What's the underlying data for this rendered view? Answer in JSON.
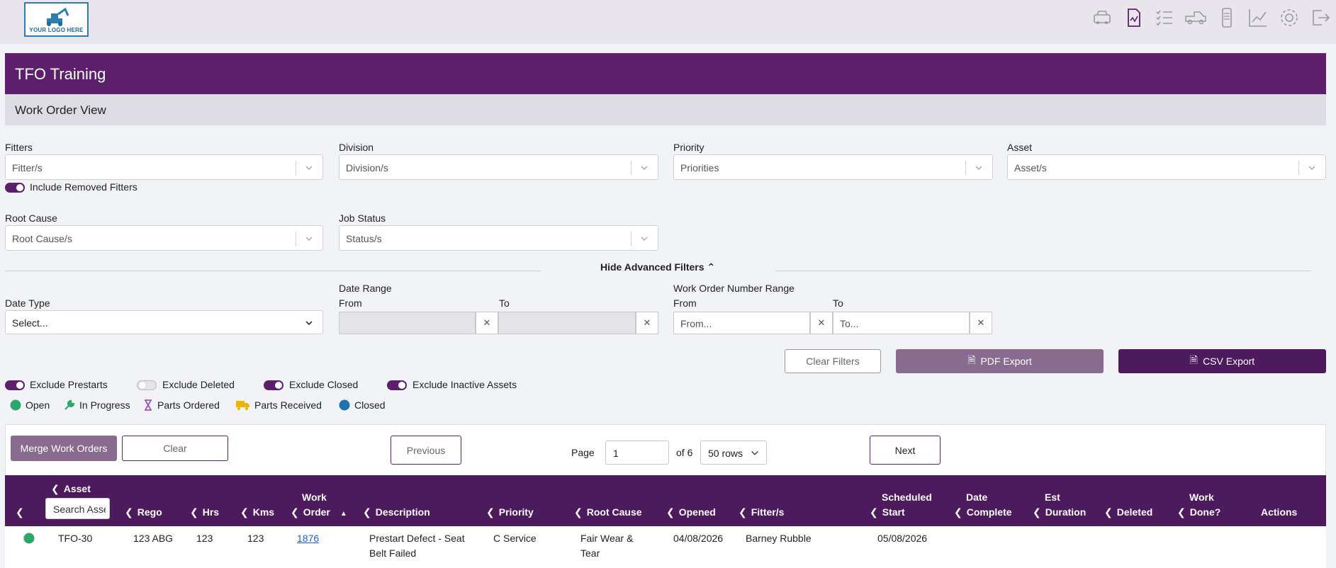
{
  "topbar": {
    "logo_text": "YOUR LOGO HERE",
    "icons": [
      "car-icon",
      "report-icon",
      "checklist-icon",
      "truck-icon",
      "mobile-icon",
      "chart-icon",
      "settings-icon",
      "logout-icon"
    ]
  },
  "header": {
    "title": "TFO Training",
    "subtitle": "Work Order View"
  },
  "filters": {
    "fitters": {
      "label": "Fitters",
      "placeholder": "Fitter/s"
    },
    "division": {
      "label": "Division",
      "placeholder": "Division/s"
    },
    "priority": {
      "label": "Priority",
      "placeholder": "Priorities"
    },
    "asset": {
      "label": "Asset",
      "placeholder": "Asset/s"
    },
    "include_removed": "Include Removed Fitters",
    "root_cause": {
      "label": "Root Cause",
      "placeholder": "Root Cause/s"
    },
    "job_status": {
      "label": "Job Status",
      "placeholder": "Status/s"
    },
    "hide_advanced": "Hide Advanced Filters",
    "date_type": {
      "label": "Date Type",
      "value": "Select..."
    },
    "date_range": {
      "label": "Date Range",
      "from": "From",
      "to": "To"
    },
    "wo_range": {
      "label": "Work Order Number Range",
      "from": "From",
      "to": "To",
      "from_placeholder": "From...",
      "to_placeholder": "To..."
    }
  },
  "actions": {
    "clear_filters": "Clear Filters",
    "pdf_export": "PDF Export",
    "csv_export": "CSV Export"
  },
  "toggles": [
    {
      "label": "Exclude Prestarts",
      "on": true
    },
    {
      "label": "Exclude Deleted",
      "on": false
    },
    {
      "label": "Exclude Closed",
      "on": true
    },
    {
      "label": "Exclude Inactive Assets",
      "on": true
    }
  ],
  "legend": [
    {
      "label": "Open",
      "icon": "open-circle",
      "color": "#2aa86a"
    },
    {
      "label": "In Progress",
      "icon": "wrench",
      "color": "#2aa86a"
    },
    {
      "label": "Parts Ordered",
      "icon": "hourglass",
      "color": "#9b59b6"
    },
    {
      "label": "Parts Received",
      "icon": "truck",
      "color": "#f0b400"
    },
    {
      "label": "Closed",
      "icon": "closed-circle",
      "color": "#1f73b0"
    }
  ],
  "toolbar": {
    "merge": "Merge Work Orders",
    "clear": "Clear",
    "previous": "Previous",
    "page_label": "Page",
    "page_value": "1",
    "of_label": "of 6",
    "rows_value": "50 rows",
    "next": "Next"
  },
  "table": {
    "headers": {
      "asset": "Asset",
      "search_placeholder": "Search Asset",
      "rego": "Rego",
      "hrs": "Hrs",
      "kms": "Kms",
      "work_order_1": "Work",
      "work_order_2": "Order",
      "description": "Description",
      "priority": "Priority",
      "root_cause": "Root Cause",
      "opened": "Opened",
      "fitters": "Fitter/s",
      "scheduled_1": "Scheduled",
      "scheduled_2": "Start",
      "date_complete_1": "Date",
      "date_complete_2": "Complete",
      "est_duration_1": "Est",
      "est_duration_2": "Duration",
      "deleted": "Deleted",
      "work_done_1": "Work",
      "work_done_2": "Done?",
      "actions": "Actions"
    },
    "rows": [
      {
        "asset": "TFO-30",
        "rego": "123 ABG",
        "hrs": "123",
        "kms": "123",
        "work_order": "1876",
        "description_1": "Prestart Defect - Seat",
        "description_2": "Belt Failed",
        "priority": "C Service",
        "root_cause_1": "Fair Wear &",
        "root_cause_2": "Tear",
        "opened": "04/08/2026",
        "fitters": "Barney Rubble",
        "scheduled_start": "05/08/2026"
      }
    ]
  }
}
